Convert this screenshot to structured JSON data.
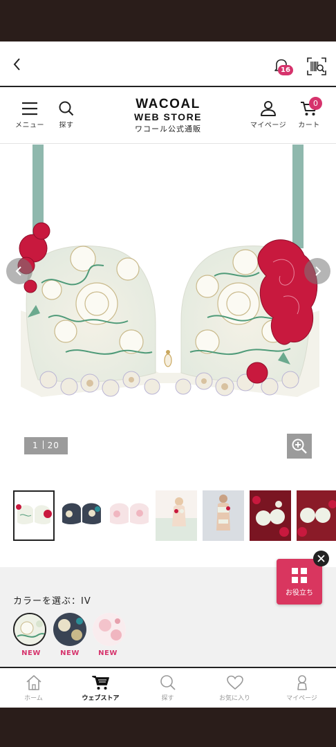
{
  "browser_bar": {
    "notification_count": "16",
    "icons": [
      "back-chevron-icon",
      "bell-icon",
      "barcode-scan-icon"
    ]
  },
  "header": {
    "menu_label": "メニュー",
    "search_label": "探す",
    "logo_line1": "WACOAL",
    "logo_line2": "WEB STORE",
    "logo_line3": "ワコール公式通販",
    "mypage_label": "マイページ",
    "cart_label": "カート",
    "cart_count": "0"
  },
  "gallery": {
    "current": "1",
    "total": "20",
    "thumbnail_count": 7
  },
  "colors": {
    "label": "カラーを選ぶ：IV",
    "swatches": [
      {
        "new_label": "NEW"
      },
      {
        "new_label": "NEW"
      },
      {
        "new_label": "NEW"
      }
    ]
  },
  "help_button": {
    "label": "お役立ち"
  },
  "tabbar": {
    "tabs": [
      {
        "label": "ホーム"
      },
      {
        "label": "ウェブストア"
      },
      {
        "label": "探す"
      },
      {
        "label": "お気に入り"
      },
      {
        "label": "マイページ"
      }
    ],
    "active_index": 1
  },
  "theme": {
    "accent": "#d6336c",
    "fab": "#d9365f",
    "ink": "#222222",
    "muted_gray": "#9b9b9b"
  }
}
